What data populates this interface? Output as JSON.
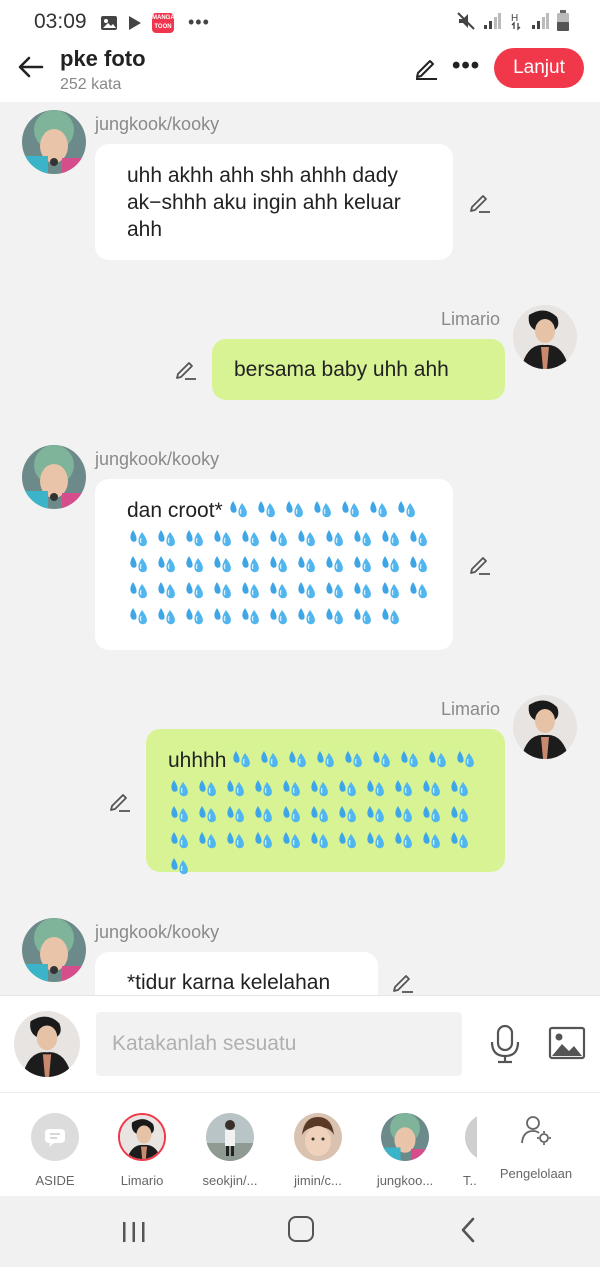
{
  "status_bar": {
    "time": "03:09"
  },
  "header": {
    "title": "pke foto",
    "subtitle": "252 kata",
    "next_label": "Lanjut"
  },
  "messages": [
    {
      "side": "left",
      "author": "jungkook/kooky",
      "text": "uhh akhh ahh shh ahhh dady ak−shhh  aku ingin ahh keluar ahh"
    },
    {
      "side": "right",
      "author": "Limario",
      "text": "bersama baby uhh ahh"
    },
    {
      "side": "left",
      "author": "jungkook/kooky",
      "text": "dan croot*",
      "drops": 50
    },
    {
      "side": "right",
      "author": "Limario",
      "text": "uhhhh",
      "drops": 43
    },
    {
      "side": "left",
      "author": "jungkook/kooky",
      "text": "*tidur karna kelelahan"
    }
  ],
  "input": {
    "placeholder": "Katakanlah sesuatu"
  },
  "characters": [
    {
      "label": "ASIDE"
    },
    {
      "label": "Limario"
    },
    {
      "label": "seokjin/..."
    },
    {
      "label": "jimin/c..."
    },
    {
      "label": "jungkoo..."
    },
    {
      "label": "T..."
    }
  ],
  "manage_label": "Pengelolaan",
  "icons": [
    "back-arrow-icon",
    "pencil-icon",
    "more-icon",
    "microphone-icon",
    "image-icon",
    "gear-person-icon",
    "water-drop-icon"
  ]
}
